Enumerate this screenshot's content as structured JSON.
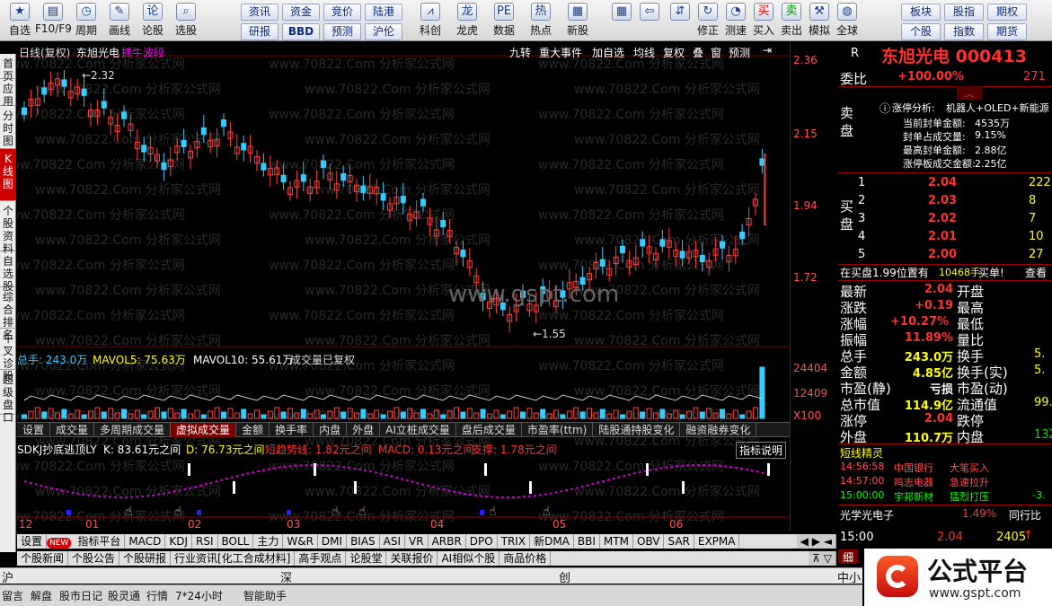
{
  "toolbar": {
    "buttons": [
      {
        "label": "自选",
        "icon": "star-icon"
      },
      {
        "label": "F10/F9",
        "icon": "f10-icon"
      },
      {
        "label": "周期",
        "icon": "clock-icon"
      },
      {
        "label": "画线",
        "icon": "pencil-icon"
      },
      {
        "label": "论股",
        "icon": "chat-icon"
      },
      {
        "label": "选股",
        "icon": "magnifier-icon"
      }
    ],
    "small_buttons": [
      [
        "资讯",
        "资金",
        "竞价",
        "陆港"
      ],
      [
        "研报",
        "BBD",
        "预测",
        "沪伦"
      ]
    ],
    "buttons2": [
      {
        "label": "科创",
        "icon": "chart-icon"
      },
      {
        "label": "龙虎",
        "icon": "dragon-icon"
      },
      {
        "label": "数据",
        "icon": "pe-icon"
      },
      {
        "label": "热点",
        "icon": "hot-icon"
      },
      {
        "label": "新股",
        "icon": "newstock-icon"
      }
    ],
    "buttons3": [
      {
        "label": "",
        "icon": "grid-icon"
      },
      {
        "label": "",
        "icon": "back-arrow-icon"
      },
      {
        "label": "",
        "icon": "up-down-icon"
      },
      {
        "label": "修正",
        "icon": "refresh-icon"
      },
      {
        "label": "测速",
        "icon": "speed-icon"
      },
      {
        "label": "买入",
        "icon": "buy-icon"
      },
      {
        "label": "卖出",
        "icon": "sell-icon"
      },
      {
        "label": "模拟",
        "icon": "hammer-icon"
      },
      {
        "label": "全球",
        "icon": "globe-icon"
      }
    ],
    "small_buttons2": [
      [
        "板块",
        "股指",
        "期权"
      ],
      [
        "个股",
        "指数",
        "期货"
      ]
    ]
  },
  "leftnav": [
    "首页",
    "应用",
    "分时图",
    "K线图",
    "个股资料",
    "自选股",
    "综合排名",
    "牛叉诊股",
    "超级盘口"
  ],
  "chart_header": {
    "period": "日线(复权)",
    "stock": "东旭光电",
    "indicator": "抓牛波段",
    "tools": [
      "九转",
      "重大事件",
      "加自选",
      "均线",
      "复权",
      "叠",
      "窗",
      "预测"
    ]
  },
  "price_axis": [
    "2.36",
    "2.15",
    "1.94",
    "1.72"
  ],
  "price_marks": {
    "high": "2.32",
    "low": "1.55"
  },
  "volume_header": {
    "total": "总手: 243.0万",
    "mavol5": "MAVOL5: 75.63万",
    "mavol10": "MAVOL10: 55.61万",
    "note": "成交量已复权"
  },
  "volume_axis": [
    "24404",
    "12409",
    "X100"
  ],
  "indicator_tabs": [
    "设置",
    "成交量",
    "多周期成交量",
    "虚拟成交量",
    "金额",
    "换手率",
    "内盘",
    "外盘",
    "AI立桩成交量",
    "盘后成交量",
    "市盈率(ttm)",
    "陆股通持股变化",
    "融资融券变化"
  ],
  "lower_indicator": {
    "name": "SDKJ抄底逃顶LY",
    "k": "K: 83.61元之间",
    "d": "D: 76.73元之间",
    "short": "短趋势线: 1.82元之间",
    "macd": "MACD: 0.13元之间",
    "support": "支撑: 1.78元之间",
    "help": "指标说明"
  },
  "month_labels": [
    "12",
    "01",
    "02",
    "03",
    "04",
    "05",
    "06"
  ],
  "bottom_tabs": [
    "设置",
    "NEW",
    "指标平台",
    "MACD",
    "KDJ",
    "RSI",
    "BOLL",
    "主力",
    "W&R",
    "DMI",
    "BIAS",
    "ASI",
    "VR",
    "ARBR",
    "DPO",
    "TRIX",
    "新DMA",
    "BBI",
    "MTM",
    "OBV",
    "SAR",
    "EXPMA"
  ],
  "news_tabs": [
    "个股新闻",
    "个股公告",
    "个股研报",
    "行业资讯[化工合成材料]",
    "高手观点",
    "论股堂",
    "关联报价",
    "AI相似个股",
    "商品价格"
  ],
  "index_bar": [
    "沪",
    "深",
    "创",
    "中小"
  ],
  "status_bar": [
    "留言",
    "解盘",
    "股市日记",
    "股灵通",
    "行情",
    "7*24小时",
    "智能助手"
  ],
  "right": {
    "letter": "R",
    "title": "东旭光电 000413",
    "weibi_label": "委比",
    "weibi_value": "+100.00%",
    "weibi_extra": "271",
    "limit_analysis": {
      "label": "涨停分析:",
      "concepts": "机器人+OLED+新能源",
      "rows": [
        [
          "当前封单金额:",
          "4535万"
        ],
        [
          "封单占成交量:",
          "9.15%"
        ],
        [
          "最高封单金额:",
          "2.88亿"
        ],
        [
          "涨停板成交金额:",
          "2.25亿"
        ]
      ]
    },
    "sell_label": "卖盘",
    "buy_label": "买盘",
    "bids": [
      {
        "lvl": "1",
        "price": "2.04",
        "vol": "222"
      },
      {
        "lvl": "2",
        "price": "2.03",
        "vol": "8"
      },
      {
        "lvl": "3",
        "price": "2.02",
        "vol": "7"
      },
      {
        "lvl": "4",
        "price": "2.01",
        "vol": "10"
      },
      {
        "lvl": "5",
        "price": "2.00",
        "vol": "27"
      }
    ],
    "queue": {
      "text": "在买盘1.99位置有",
      "vol": "10468手",
      "action": "买单!",
      "view": "查看"
    },
    "stats": [
      {
        "l": "最新",
        "v": "2.04",
        "l2": "开盘",
        "v2": ""
      },
      {
        "l": "涨跌",
        "v": "+0.19",
        "l2": "最高",
        "v2": ""
      },
      {
        "l": "涨幅",
        "v": "+10.27%",
        "l2": "最低",
        "v2": ""
      },
      {
        "l": "振幅",
        "v": "11.89%",
        "l2": "量比",
        "v2": ""
      },
      {
        "l": "总手",
        "v": "243.0万",
        "l2": "换手",
        "v2": "5."
      },
      {
        "l": "金额",
        "v": "4.85亿",
        "l2": "换手(实)",
        "v2": "5."
      },
      {
        "l": "市盈(静)",
        "v": "亏损",
        "l2": "市盈(动)",
        "v2": ""
      },
      {
        "l": "总市值",
        "v": "114.9亿",
        "l2": "流通值",
        "v2": "99."
      },
      {
        "l": "涨停",
        "v": "2.04",
        "l2": "跌停",
        "v2": ""
      },
      {
        "l": "外盘",
        "v": "110.7万",
        "l2": "内盘",
        "v2": "132."
      }
    ],
    "short_elf_title": "短线精灵",
    "short_elf": [
      {
        "t": "14:56:58",
        "name": "中国银行",
        "ev": "大笔买入",
        "v": ""
      },
      {
        "t": "14:57:00",
        "name": "鸣志电器",
        "ev": "急速拉升",
        "v": ""
      },
      {
        "t": "15:00:00",
        "name": "宇邦新材",
        "ev": "猛烈打压",
        "v": "-3."
      }
    ],
    "sector": {
      "name": "光学光电子",
      "chg": "1.49%",
      "next": "同行比"
    },
    "tick": {
      "time": "15:00",
      "price": "2.04",
      "vol": "2405"
    },
    "tick_tab": "细"
  },
  "watermark": {
    "mid": "www.gspt.com",
    "brand": "公式平台",
    "url": "www.gspt.com"
  }
}
